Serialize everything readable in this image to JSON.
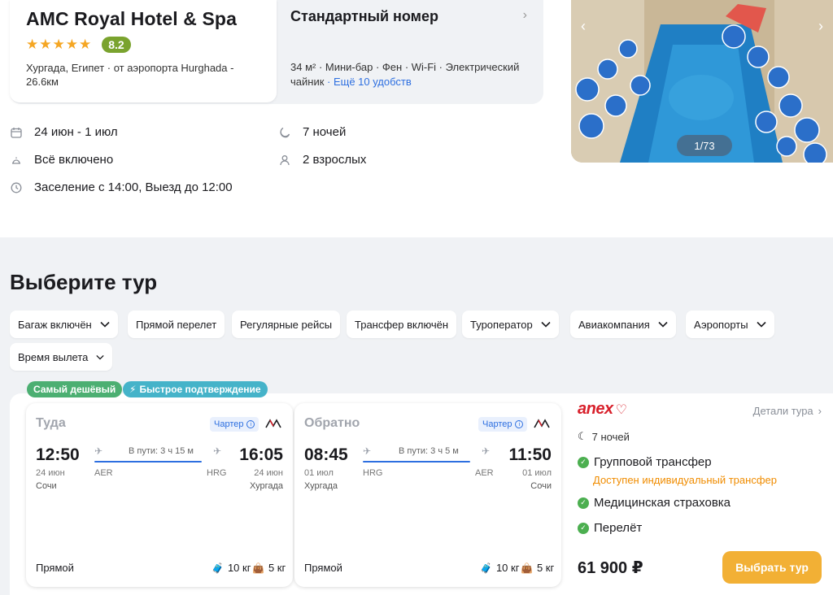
{
  "hotel": {
    "name": "AMC Royal Hotel & Spa",
    "stars": "★★★★★",
    "score": "8.2",
    "location": "Хургада, Египет · от аэропорта Hurghada - 26.6км"
  },
  "room": {
    "title": "Стандартный номер",
    "features": "34 м² · Мини-бар · Фен · Wi-Fi · Электрический чайник",
    "more": " · Ещё 10 удобств"
  },
  "details": {
    "dates": "24 июн - 1 июл",
    "nights": "7 ночей",
    "meals": "Всё включено",
    "guests": "2 взрослых",
    "checkin": "Заселение с 14:00, Выезд до 12:00"
  },
  "photo": {
    "counter": "1/73"
  },
  "section_title": "Выберите тур",
  "filters": [
    {
      "label": "Багаж включён"
    },
    {
      "label": "Прямой перелет"
    },
    {
      "label": "Регулярные рейсы"
    },
    {
      "label": "Трансфер включён"
    },
    {
      "label": "Туроператор"
    },
    {
      "label": "Авиакомпания"
    },
    {
      "label": "Аэропорты"
    },
    {
      "label": "Время вылета"
    }
  ],
  "badges": {
    "cheapest": "Самый дешёвый",
    "fast": "Быстрое подтверждение"
  },
  "flights": [
    {
      "dir": "Туда",
      "charter": "Чартер",
      "dep_time": "12:50",
      "dep_date": "24 июн",
      "dep_city": "Сочи",
      "dep_code": "AER",
      "duration": "В пути: 3 ч 15 м",
      "arr_time": "16:05",
      "arr_date": "24 июн",
      "arr_city": "Хургада",
      "arr_code": "HRG",
      "type": "Прямой",
      "bag": "10 кг",
      "hand": "5 кг"
    },
    {
      "dir": "Обратно",
      "charter": "Чартер",
      "dep_time": "08:45",
      "dep_date": "01 июл",
      "dep_city": "Хургада",
      "dep_code": "HRG",
      "duration": "В пути: 3 ч 5 м",
      "arr_time": "11:50",
      "arr_date": "01 июл",
      "arr_city": "Сочи",
      "arr_code": "AER",
      "type": "Прямой",
      "bag": "10 кг",
      "hand": "5 кг"
    }
  ],
  "operator": {
    "logo": "anex",
    "details_link": "Детали тура",
    "nights": "7 ночей",
    "transfer": "Групповой трансфер",
    "transfer_sub": "Доступен индивидуальный трансфер",
    "insurance": "Медицинская страховка",
    "flight": "Перелёт",
    "price": "61 900 ₽",
    "choose": "Выбрать тур"
  },
  "colors": {
    "accent": "#2d6fe0",
    "cta": "#f2b035",
    "score": "#7aa32e",
    "badge_green": "#4caf72",
    "badge_blue": "#45b3c9",
    "anex_red": "#d8202b"
  }
}
